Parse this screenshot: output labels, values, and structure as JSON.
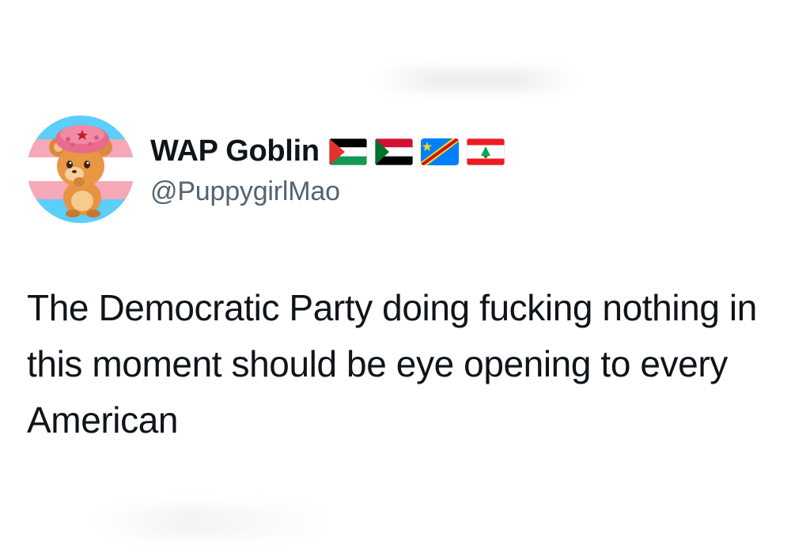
{
  "user": {
    "display_name": "WAP Goblin",
    "handle": "@PuppygirlMao",
    "flags": [
      "palestine-flag-icon",
      "sudan-flag-icon",
      "dr-congo-flag-icon",
      "lebanon-flag-icon"
    ]
  },
  "tweet": {
    "text": "The Democratic Party doing fucking nothing in this moment should be eye opening to every American"
  },
  "colors": {
    "text": "#0f1419",
    "secondary_text": "#536471",
    "background": "#ffffff",
    "trans_blue": "#5BCEFA",
    "trans_pink": "#F5A9B8"
  }
}
